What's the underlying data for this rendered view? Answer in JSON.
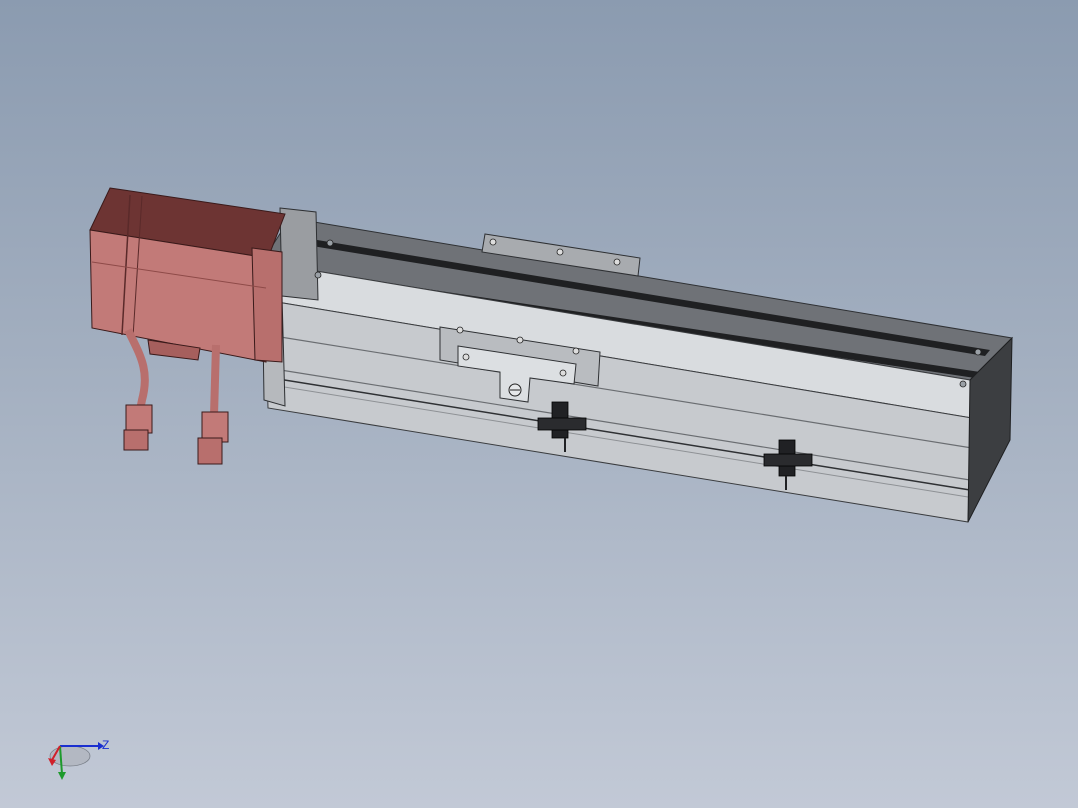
{
  "viewport": {
    "background_top": "#8b9bb0",
    "background_bottom": "#c2c9d6"
  },
  "model": {
    "motor_color": "#c27a78",
    "motor_dark": "#8a4443",
    "rail_color": "#cdd0d3",
    "rail_dark": "#5f6266"
  },
  "triad": {
    "z_label": "Z",
    "z_color": "#1a2fd0",
    "y_color": "#1e9a2c",
    "x_color": "#d0202a"
  }
}
